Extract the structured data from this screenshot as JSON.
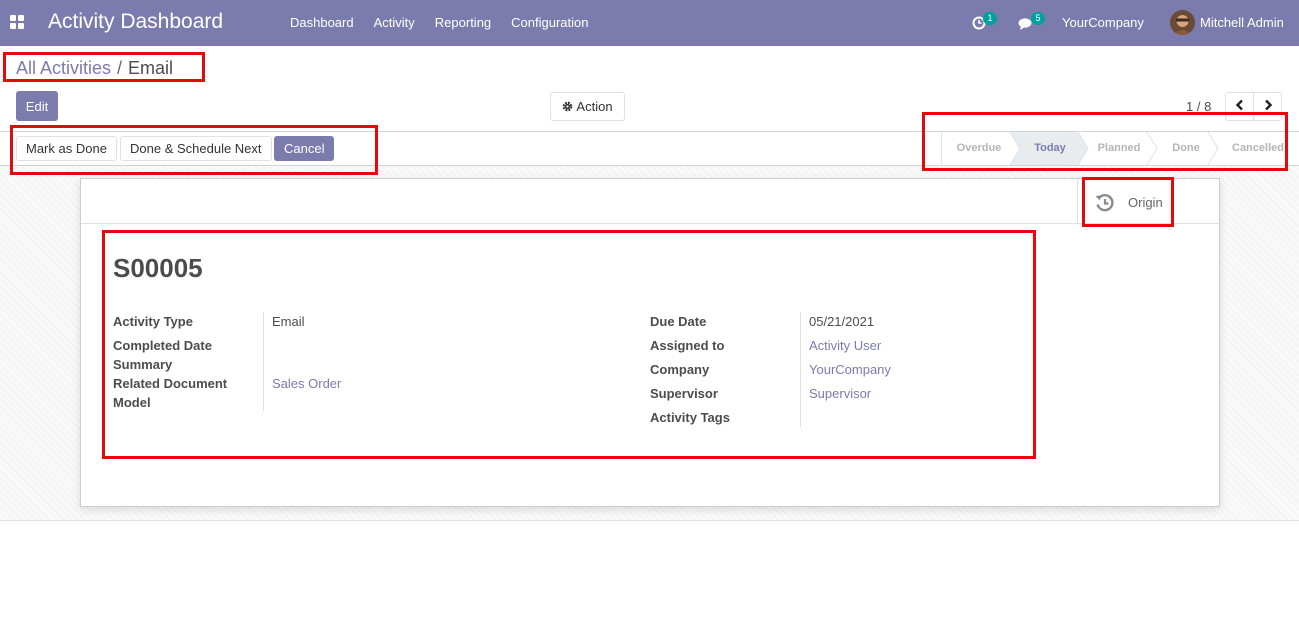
{
  "navbar": {
    "app_title": "Activity Dashboard",
    "menu": [
      "Dashboard",
      "Activity",
      "Reporting",
      "Configuration"
    ],
    "activity_count": "1",
    "message_count": "5",
    "company": "YourCompany",
    "user": "Mitchell Admin"
  },
  "breadcrumb": {
    "parent": "All Activities",
    "separator": "/",
    "current": "Email"
  },
  "control_panel": {
    "edit_label": "Edit",
    "action_label": "Action",
    "pager_value": "1 / 8"
  },
  "statusbar": {
    "buttons": [
      "Mark as Done",
      "Done & Schedule Next",
      "Cancel"
    ],
    "stages": [
      "Overdue",
      "Today",
      "Planned",
      "Done",
      "Cancelled"
    ],
    "active_stage": "Today"
  },
  "form": {
    "origin_label": "Origin",
    "title": "S00005",
    "left_fields": [
      {
        "label": "Activity Type",
        "value": "Email"
      },
      {
        "label": "Completed Date",
        "value": ""
      },
      {
        "label": "Summary",
        "value": ""
      },
      {
        "label": "Related Document Model",
        "value": "Sales Order"
      }
    ],
    "right_fields": [
      {
        "label": "Due Date",
        "value": "05/21/2021"
      },
      {
        "label": "Assigned to",
        "value": "Activity User"
      },
      {
        "label": "Company",
        "value": "YourCompany"
      },
      {
        "label": "Supervisor",
        "value": "Supervisor"
      },
      {
        "label": "Activity Tags",
        "value": ""
      }
    ]
  },
  "colors": {
    "brand": "#7c7bad",
    "badge": "#00a09d",
    "annotation": "#e8070b"
  },
  "icons": [
    "apps-icon",
    "activity-clock-icon",
    "chat-icon",
    "gear-icon",
    "chevron-left-icon",
    "chevron-right-icon",
    "history-icon"
  ]
}
